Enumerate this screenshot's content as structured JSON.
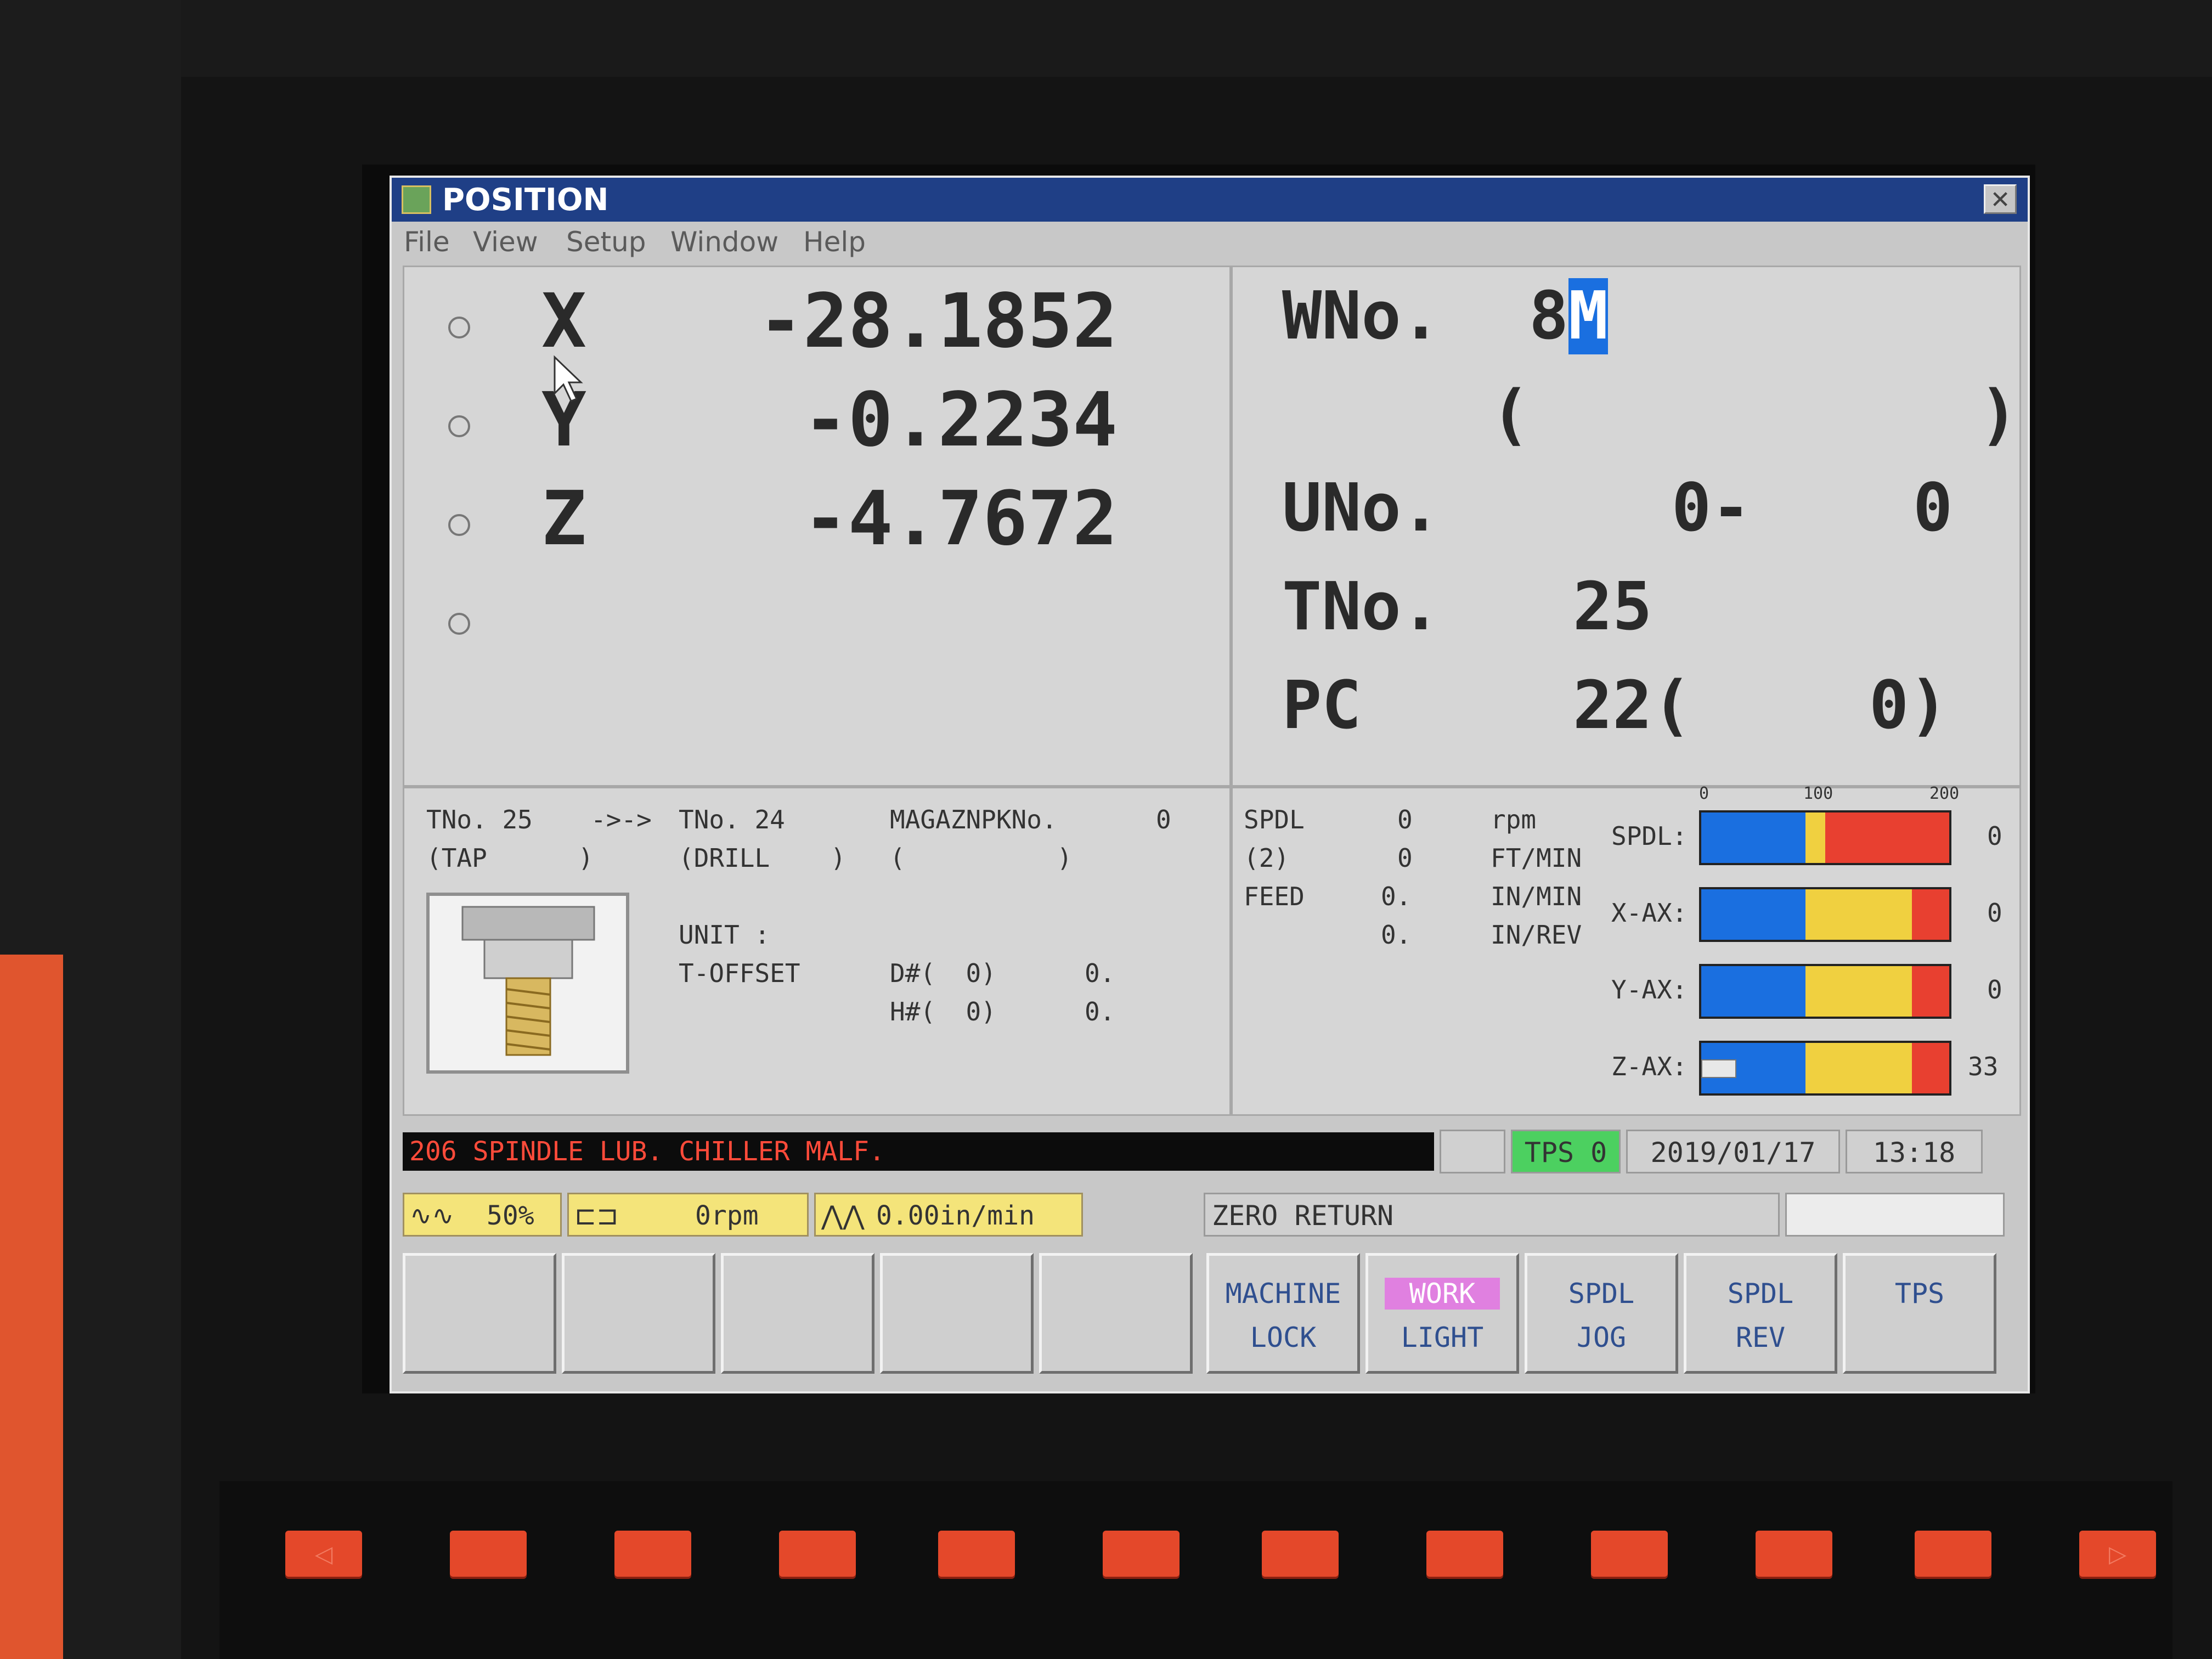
{
  "window": {
    "title": "POSITION"
  },
  "menu": [
    "File",
    "View",
    "Setup",
    "Window",
    "Help"
  ],
  "positions": [
    {
      "axis": "X",
      "value": "-28.1852"
    },
    {
      "axis": "Y",
      "value": "-0.2234"
    },
    {
      "axis": "Z",
      "value": "-4.7672"
    },
    {
      "axis": "",
      "value": ""
    }
  ],
  "work": {
    "wno_label": "WNo.",
    "wno_value": "8",
    "wno_cursor": "M",
    "paren_open": "(",
    "paren_close": ")",
    "uno_label": "UNo.",
    "uno_a": "0-",
    "uno_b": "0",
    "tno_label": "TNo.",
    "tno_value": "25",
    "pc_label": "PC",
    "pc_value": "22(",
    "pc_sub": "0)"
  },
  "tool_info": {
    "current": "TNo. 25",
    "arrow": "->->",
    "next": "TNo. 24",
    "current_type": "(TAP      )",
    "next_type": "(DRILL    )",
    "magazine_label": "MAGAZNPKNo.",
    "magazine_value": "0",
    "magazine_paren": "(          )",
    "unit": "UNIT :",
    "toffset": "T-OFFSET",
    "d_label": "D#(  0)",
    "d_value": "0.",
    "h_label": "H#(  0)",
    "h_value": "0."
  },
  "spindle": {
    "rows": [
      {
        "label": "SPDL",
        "value": "0",
        "unit": "rpm"
      },
      {
        "label": "(2)",
        "value": "0",
        "unit": "FT/MIN"
      },
      {
        "label": "FEED",
        "value": "0.",
        "unit": "IN/MIN"
      },
      {
        "label": "",
        "value": "0.",
        "unit": "IN/REV"
      }
    ],
    "scale": [
      "0",
      "100",
      "200"
    ],
    "meters": [
      {
        "label": "SPDL:",
        "value": "0",
        "level": 0
      },
      {
        "label": "X-AX:",
        "value": "0",
        "level": 0
      },
      {
        "label": "Y-AX:",
        "value": "0",
        "level": 0
      },
      {
        "label": "Z-AX:",
        "value": "33",
        "level": 0.065
      }
    ]
  },
  "status": {
    "alarm": "206 SPINDLE LUB. CHILLER MALF.",
    "tps": "TPS 0",
    "date": "2019/01/17",
    "time": "13:18",
    "override": "50%",
    "spindle_speed": "0rpm",
    "feed": "0.00in/min",
    "mode": "ZERO RETURN"
  },
  "softkeys": [
    {
      "l1": "",
      "l2": ""
    },
    {
      "l1": "",
      "l2": ""
    },
    {
      "l1": "",
      "l2": ""
    },
    {
      "l1": "",
      "l2": ""
    },
    {
      "l1": "",
      "l2": ""
    },
    {
      "l1": "MACHINE",
      "l2": "LOCK"
    },
    {
      "l1": "WORK",
      "l2": "LIGHT"
    },
    {
      "l1": "SPDL",
      "l2": "JOG"
    },
    {
      "l1": "SPDL",
      "l2": "REV"
    },
    {
      "l1": "TPS",
      "l2": ""
    }
  ],
  "colors": {
    "title_bg": "#1f3f86",
    "alarm_text": "#ff4b3a",
    "meter_blue": "#1a6fe0",
    "meter_yellow": "#f0d040",
    "meter_red": "#e84030",
    "hw_key": "#e4482a"
  }
}
